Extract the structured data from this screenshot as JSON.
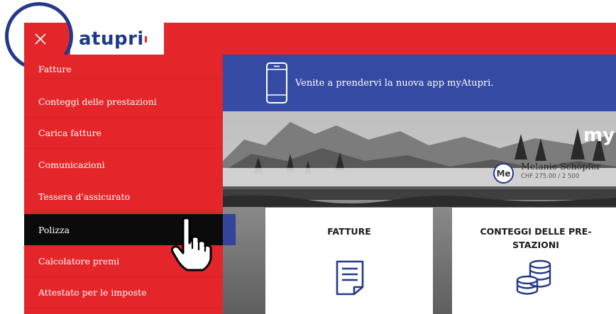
{
  "header": {
    "close_label": "×",
    "logo_text": "atupri"
  },
  "sidebar": {
    "items": [
      {
        "label": "Fatture",
        "active": false
      },
      {
        "label": "Conteggi delle prestazioni",
        "active": false
      },
      {
        "label": "Carica fatture",
        "active": false
      },
      {
        "label": "Comunicazioni",
        "active": false
      },
      {
        "label": "Tessera d'assicurato",
        "active": false
      },
      {
        "label": "Polizza",
        "active": true
      },
      {
        "label": "Calcolatore premi",
        "active": false
      },
      {
        "label": "Attestato per le imposte",
        "active": false
      }
    ]
  },
  "banner": {
    "text": "Venite a prendervi la nuova app myAtupri.",
    "icon": "smartphone-icon"
  },
  "hero": {
    "brand_text": "my"
  },
  "user": {
    "initials": "Me",
    "name": "Melanie Schöpfer",
    "amount": "CHF 275.00 / 2 500"
  },
  "cards": [
    {
      "title": "FATTURE",
      "icon": "invoice-document-icon"
    },
    {
      "title": "CONTEGGI DELLE PRE-\nSTAZIONI",
      "icon": "coin-stack-icon"
    }
  ],
  "colors": {
    "brand_red": "#e4262a",
    "brand_blue": "#2b42a0",
    "active_item": "#0b0b0b",
    "highlight_ring": "#23398a"
  }
}
